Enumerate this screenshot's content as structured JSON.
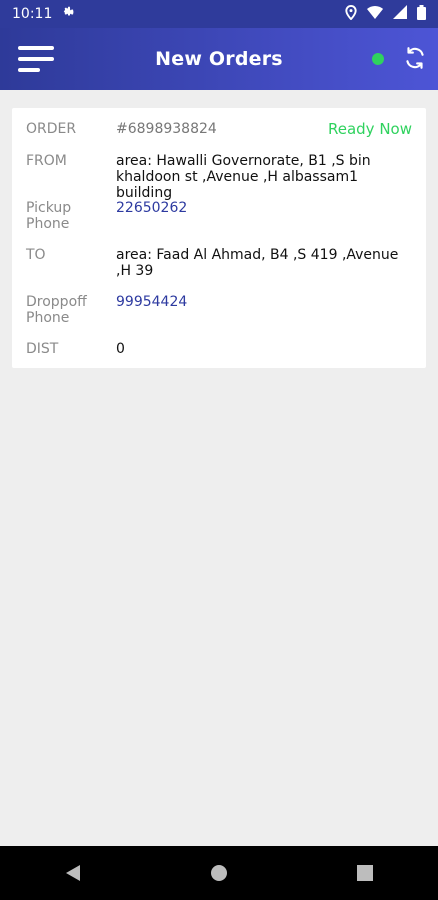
{
  "status_bar": {
    "time": "10:11",
    "icons": [
      "gear-icon",
      "location-icon",
      "wifi-icon",
      "signal-icon",
      "battery-icon"
    ]
  },
  "app_bar": {
    "title": "New Orders",
    "online_status_color": "#2fd25e",
    "accent_gradient": [
      "#2e3a99",
      "#4d55d6"
    ]
  },
  "order": {
    "order_label": "ORDER",
    "order_number": "#6898938824",
    "status": "Ready Now",
    "from_label": "FROM",
    "from_value": "area: Hawalli Governorate, B1 ,S bin khaldoon st ,Avenue ,H albassam1 building",
    "pickup_label": "Pickup Phone",
    "pickup_phone": "22650262",
    "to_label": "TO",
    "to_value": "area: Faad Al Ahmad, B4 ,S 419 ,Avenue ,H 39",
    "dropoff_label": "Droppoff Phone",
    "dropoff_phone": "99954424",
    "dist_label": "DIST",
    "dist_value": "0"
  }
}
